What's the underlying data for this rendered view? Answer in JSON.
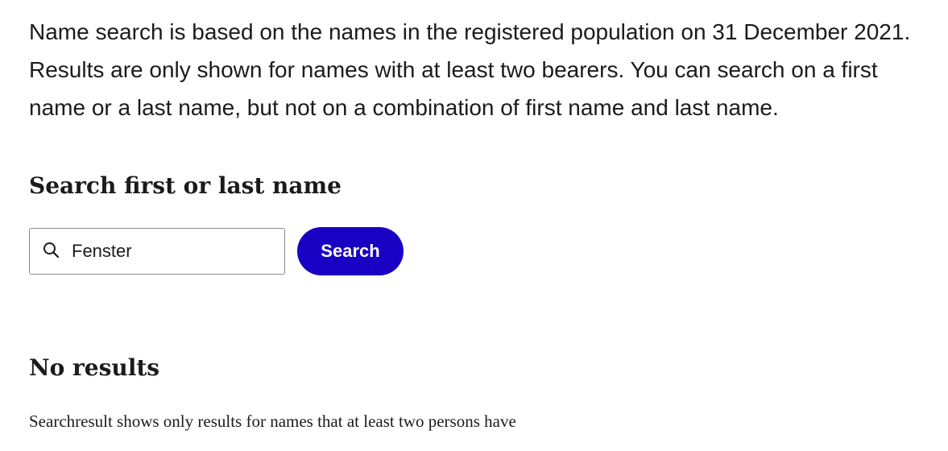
{
  "intro": {
    "text": "Name search is based on the names in the registered population on 31 December 2021. Results are only shown for names with at least two bearers. You can search on a first name or a last name, but not on a combination of first name and last name."
  },
  "search": {
    "heading": "Search first or last name",
    "input_value": "Fenster",
    "icon": "search-icon",
    "button_label": "Search"
  },
  "results": {
    "heading": "No results",
    "note": "Searchresult shows only results for names that at least two persons have"
  },
  "colors": {
    "accent": "#1a00c2",
    "text": "#1b1b1b",
    "input_border": "#8a8a8a",
    "background": "#ffffff"
  }
}
